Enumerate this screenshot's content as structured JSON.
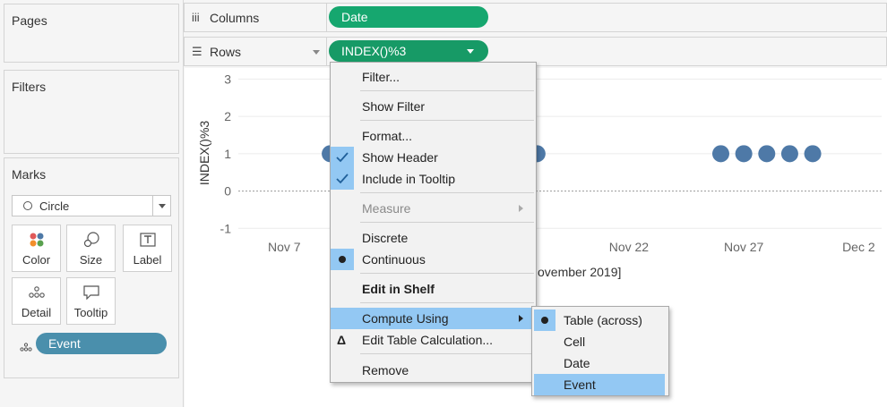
{
  "sidebar": {
    "pages_title": "Pages",
    "filters_title": "Filters",
    "marks_title": "Marks",
    "mark_type": "Circle",
    "mark_buttons": [
      {
        "label": "Color",
        "icon": "color-dots-icon"
      },
      {
        "label": "Size",
        "icon": "size-icon"
      },
      {
        "label": "Label",
        "icon": "label-icon"
      },
      {
        "label": "Detail",
        "icon": "detail-icon"
      },
      {
        "label": "Tooltip",
        "icon": "tooltip-icon"
      }
    ],
    "detail_field": "Event"
  },
  "shelves": {
    "columns_label": "Columns",
    "columns_pill": "Date",
    "rows_label": "Rows",
    "rows_pill": "INDEX()%3"
  },
  "colors": {
    "green_pill": "#16a76f",
    "blue_pill": "#4a8fac",
    "mark": "#4e79a7",
    "highlight": "#93c8f3"
  },
  "chart_data": {
    "type": "scatter",
    "ylabel": "INDEX()%3",
    "xlabel_visible_fragment": "ovember 2019]",
    "y_ticks": [
      "3",
      "2",
      "1",
      "0",
      "-1"
    ],
    "x_ticks": [
      "Nov 7",
      "Nov 22",
      "Nov 27",
      "Dec 2"
    ],
    "ylim": [
      -1.4,
      3.2
    ],
    "xlim": [
      "2019-11-05",
      "2019-12-03"
    ],
    "points": [
      {
        "x": "2019-11-09",
        "y": 1
      },
      {
        "x": "2019-11-10",
        "y": 1
      },
      {
        "x": "2019-11-18",
        "y": 1
      },
      {
        "x": "2019-11-26",
        "y": 1
      },
      {
        "x": "2019-11-27",
        "y": 1
      },
      {
        "x": "2019-11-28",
        "y": 1
      },
      {
        "x": "2019-11-29",
        "y": 1
      },
      {
        "x": "2019-11-30",
        "y": 1
      }
    ]
  },
  "context_menu": {
    "items": [
      {
        "label": "Filter...",
        "state": ""
      },
      {
        "label": "Show Filter",
        "state": ""
      },
      {
        "label": "Format...",
        "state": ""
      },
      {
        "label": "Show Header",
        "state": "checked"
      },
      {
        "label": "Include in Tooltip",
        "state": "checked"
      },
      {
        "label": "Measure",
        "state": "disabled"
      },
      {
        "label": "Discrete",
        "state": ""
      },
      {
        "label": "Continuous",
        "state": "selected"
      },
      {
        "label": "Edit in Shelf",
        "state": "bold"
      },
      {
        "label": "Compute Using",
        "state": "highlighted"
      },
      {
        "label": "Edit Table Calculation...",
        "state": ""
      },
      {
        "label": "Remove",
        "state": ""
      }
    ]
  },
  "submenu": {
    "items": [
      {
        "label": "Table (across)",
        "state": "selected"
      },
      {
        "label": "Cell",
        "state": ""
      },
      {
        "label": "Date",
        "state": ""
      },
      {
        "label": "Event",
        "state": "highlighted"
      }
    ]
  }
}
